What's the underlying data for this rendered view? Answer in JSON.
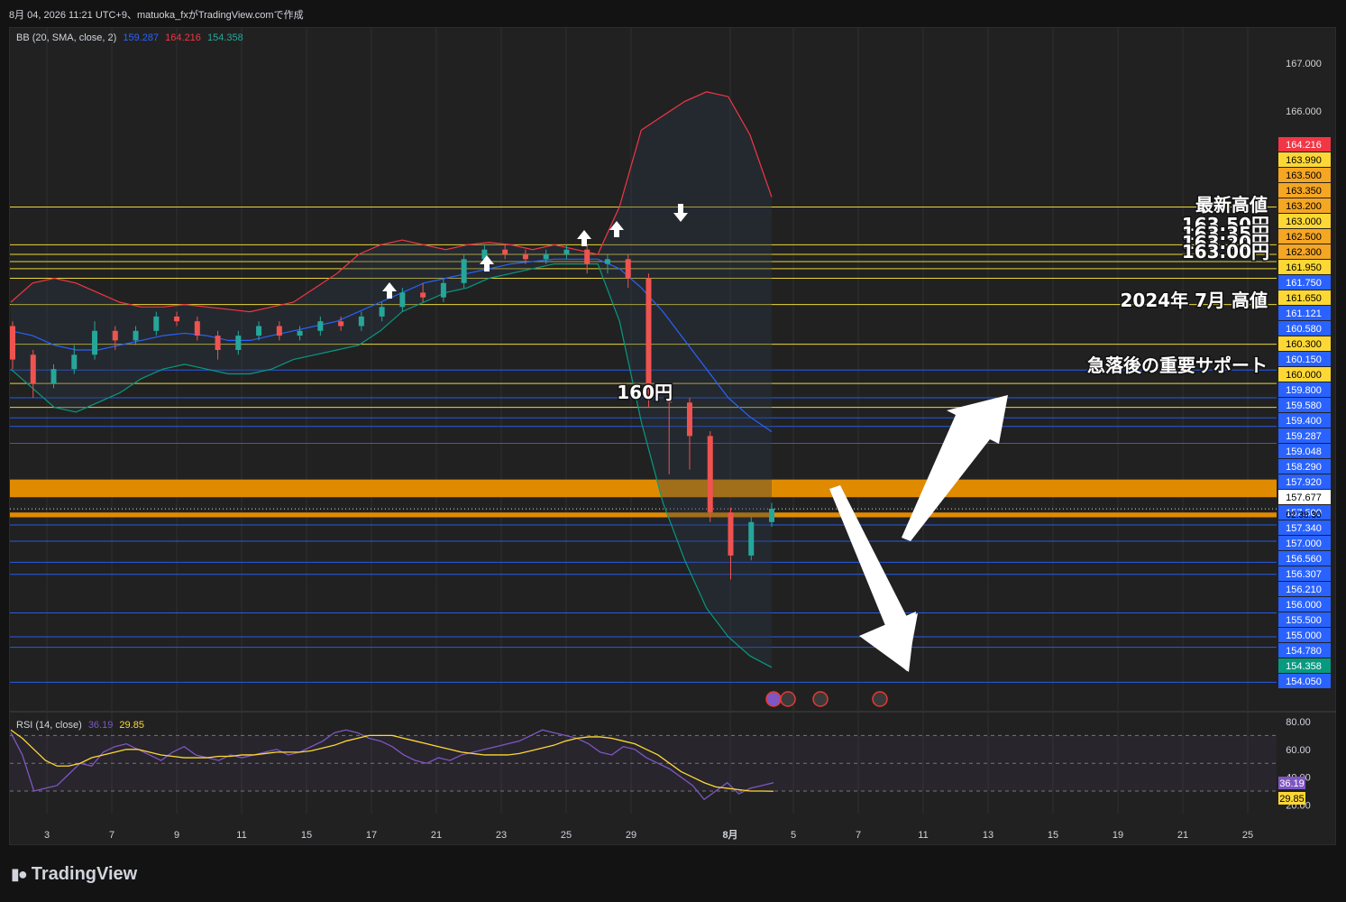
{
  "header": {
    "title": "8月 04, 2026 11:21 UTC+9、matuoka_fxがTradingView.comで作成"
  },
  "bb_legend": {
    "label": "BB (20, SMA, close, 2)",
    "basis": "159.287",
    "upper": "164.216",
    "lower": "154.358"
  },
  "rsi_legend": {
    "label": "RSI (14, close)",
    "rsi": "36.19",
    "ma": "29.85"
  },
  "logo": {
    "text": "TradingView"
  },
  "annotations": {
    "latest_high": "最新高値",
    "jul2024_high": "2024年 7月 高値",
    "support": "急落後の重要サポート",
    "yen160": "160円",
    "stack1": "163.50円",
    "stack2": "163.35円",
    "stack3": "163.20円",
    "stack4": "163.00円"
  },
  "colors": {
    "background": "#212121",
    "page": "#131313",
    "up": "#26a69a",
    "down": "#ef5350",
    "bb_upper": "#f23645",
    "bb_basis": "#2962ff",
    "bb_lower": "#089981",
    "yellow_line": "#ffeb3b",
    "blue_line": "#2962ff",
    "orange_zone": "#e08a00",
    "rsi": "#7e57c2",
    "rsi_ma": "#fdd835"
  },
  "chart_data": [
    {
      "type": "candlestick",
      "title": "",
      "x_tick_labels": [
        "3",
        "7",
        "9",
        "11",
        "15",
        "17",
        "21",
        "23",
        "25",
        "29",
        "8月",
        "5",
        "7",
        "11",
        "13",
        "15",
        "19",
        "21",
        "25"
      ],
      "y_ticks": [
        167.0,
        166.0
      ],
      "ylim": [
        153.7,
        167.5
      ],
      "price_axis_labels": [
        {
          "value": "164.216",
          "type": "bb_upper"
        },
        {
          "value": "163.990",
          "type": "yellow"
        },
        {
          "value": "163.500",
          "type": "orange"
        },
        {
          "value": "163.350",
          "type": "orange"
        },
        {
          "value": "163.200",
          "type": "orange"
        },
        {
          "value": "163.000",
          "type": "yellow"
        },
        {
          "value": "162.500",
          "type": "orange"
        },
        {
          "value": "162.300",
          "type": "orange"
        },
        {
          "value": "161.950",
          "type": "yellow"
        },
        {
          "value": "161.750",
          "type": "blue"
        },
        {
          "value": "161.650",
          "type": "yellow"
        },
        {
          "value": "161.121",
          "type": "blue"
        },
        {
          "value": "160.580",
          "type": "blue"
        },
        {
          "value": "160.300",
          "type": "yellow"
        },
        {
          "value": "160.150",
          "type": "blue"
        },
        {
          "value": "160.000",
          "type": "yellow"
        },
        {
          "value": "159.800",
          "type": "blue"
        },
        {
          "value": "159.580",
          "type": "blue"
        },
        {
          "value": "159.400",
          "type": "blue"
        },
        {
          "value": "159.287",
          "type": "blue"
        },
        {
          "value": "159.048",
          "type": "blue"
        },
        {
          "value": "158.290",
          "type": "blue"
        },
        {
          "value": "157.920",
          "type": "blue"
        },
        {
          "value": "157.677",
          "type": "current"
        },
        {
          "value": "157.500",
          "type": "blue"
        },
        {
          "value": "157.340",
          "type": "blue"
        },
        {
          "value": "157.000",
          "type": "blue"
        },
        {
          "value": "156.560",
          "type": "blue"
        },
        {
          "value": "156.307",
          "type": "blue"
        },
        {
          "value": "156.210",
          "type": "blue"
        },
        {
          "value": "156.000",
          "type": "blue"
        },
        {
          "value": "155.500",
          "type": "blue"
        },
        {
          "value": "155.000",
          "type": "blue"
        },
        {
          "value": "154.780",
          "type": "blue"
        },
        {
          "value": "154.358",
          "type": "bb_lower"
        },
        {
          "value": "154.050",
          "type": "blue"
        }
      ],
      "countdown": "02:38:30",
      "horizontal_levels": [
        {
          "price": 163.99,
          "color": "yellow"
        },
        {
          "price": 163.2,
          "color": "yellow"
        },
        {
          "price": 163.0,
          "color": "yellow"
        },
        {
          "price": 162.85,
          "color": "yellow"
        },
        {
          "price": 162.7,
          "color": "yellow"
        },
        {
          "price": 162.5,
          "color": "yellow"
        },
        {
          "price": 161.95,
          "color": "yellow"
        },
        {
          "price": 161.121,
          "color": "yellow"
        },
        {
          "price": 160.58,
          "color": "blue"
        },
        {
          "price": 160.3,
          "color": "yellow"
        },
        {
          "price": 160.0,
          "color": "blue"
        },
        {
          "price": 159.8,
          "color": "yellow"
        },
        {
          "price": 159.58,
          "color": "blue"
        },
        {
          "price": 159.4,
          "color": "blue"
        },
        {
          "price": 159.048,
          "color": "blue"
        },
        {
          "price": 157.34,
          "color": "blue"
        },
        {
          "price": 157.0,
          "color": "blue"
        },
        {
          "price": 156.56,
          "color": "blue"
        },
        {
          "price": 156.307,
          "color": "blue"
        },
        {
          "price": 155.5,
          "color": "blue"
        },
        {
          "price": 155.0,
          "color": "blue"
        },
        {
          "price": 154.78,
          "color": "blue"
        },
        {
          "price": 154.05,
          "color": "blue"
        }
      ],
      "zones": [
        {
          "from": 157.92,
          "to": 158.29,
          "color": "orange"
        },
        {
          "from": 157.5,
          "to": 157.6,
          "color": "orange"
        }
      ],
      "series": [
        {
          "kind": "candles",
          "points_open_close_high_low": [
            [
              161.5,
              160.8,
              161.6,
              160.6
            ],
            [
              160.9,
              160.3,
              161.0,
              160.0
            ],
            [
              160.3,
              160.6,
              160.7,
              160.2
            ],
            [
              160.6,
              160.9,
              161.1,
              160.5
            ],
            [
              160.9,
              161.4,
              161.6,
              160.8
            ],
            [
              161.4,
              161.2,
              161.5,
              161.0
            ],
            [
              161.2,
              161.4,
              161.5,
              161.1
            ],
            [
              161.4,
              161.7,
              161.8,
              161.3
            ],
            [
              161.7,
              161.6,
              161.8,
              161.5
            ],
            [
              161.6,
              161.3,
              161.7,
              161.2
            ],
            [
              161.3,
              161.0,
              161.4,
              160.8
            ],
            [
              161.0,
              161.3,
              161.4,
              160.9
            ],
            [
              161.3,
              161.5,
              161.6,
              161.2
            ],
            [
              161.5,
              161.3,
              161.6,
              161.2
            ],
            [
              161.3,
              161.4,
              161.5,
              161.2
            ],
            [
              161.4,
              161.6,
              161.7,
              161.3
            ],
            [
              161.6,
              161.5,
              161.7,
              161.4
            ],
            [
              161.5,
              161.7,
              161.8,
              161.4
            ],
            [
              161.7,
              161.9,
              162.0,
              161.6
            ],
            [
              161.9,
              162.2,
              162.3,
              161.8
            ],
            [
              162.2,
              162.1,
              162.4,
              162.0
            ],
            [
              162.1,
              162.4,
              162.5,
              162.0
            ],
            [
              162.4,
              162.9,
              163.0,
              162.3
            ],
            [
              162.9,
              163.1,
              163.2,
              162.8
            ],
            [
              163.1,
              163.0,
              163.2,
              162.9
            ],
            [
              163.0,
              162.9,
              163.1,
              162.8
            ],
            [
              162.9,
              163.0,
              163.1,
              162.8
            ],
            [
              163.0,
              163.1,
              163.2,
              162.9
            ],
            [
              163.1,
              162.8,
              163.2,
              162.6
            ],
            [
              162.8,
              162.9,
              163.0,
              162.6
            ],
            [
              162.9,
              162.5,
              163.0,
              162.3
            ],
            [
              162.5,
              160.0,
              162.6,
              159.8
            ],
            [
              160.0,
              159.9,
              160.1,
              158.4
            ],
            [
              159.9,
              159.2,
              160.0,
              158.5
            ],
            [
              159.2,
              157.6,
              159.3,
              157.4
            ],
            [
              157.6,
              156.7,
              157.7,
              156.2
            ],
            [
              156.7,
              157.4,
              157.5,
              156.6
            ],
            [
              157.4,
              157.68,
              157.8,
              157.3
            ]
          ]
        },
        {
          "name": "",
          "kind": "bb_upper",
          "values": [
            162.0,
            162.4,
            162.5,
            162.4,
            162.2,
            162.0,
            161.9,
            161.9,
            161.95,
            161.9,
            161.85,
            161.8,
            161.9,
            162.0,
            162.3,
            162.6,
            163.0,
            163.2,
            163.3,
            163.2,
            163.1,
            163.2,
            163.25,
            163.2,
            163.1,
            163.2,
            163.1,
            163.0,
            164.0,
            165.6,
            165.9,
            166.2,
            166.4,
            166.3,
            165.5,
            164.2
          ]
        },
        {
          "name": "",
          "kind": "bb_basis",
          "values": [
            161.4,
            161.3,
            161.1,
            161.0,
            161.0,
            161.1,
            161.2,
            161.3,
            161.35,
            161.3,
            161.2,
            161.2,
            161.3,
            161.4,
            161.5,
            161.6,
            161.8,
            162.0,
            162.2,
            162.4,
            162.5,
            162.6,
            162.7,
            162.8,
            162.85,
            162.9,
            162.9,
            162.9,
            162.7,
            162.3,
            161.8,
            161.2,
            160.6,
            160.0,
            159.6,
            159.29
          ]
        },
        {
          "name": "",
          "kind": "bb_lower",
          "values": [
            160.6,
            160.2,
            159.8,
            159.7,
            159.9,
            160.1,
            160.4,
            160.6,
            160.7,
            160.6,
            160.5,
            160.5,
            160.6,
            160.8,
            160.9,
            161.0,
            161.1,
            161.4,
            161.8,
            162.0,
            162.2,
            162.3,
            162.5,
            162.6,
            162.7,
            162.8,
            162.8,
            162.8,
            161.6,
            159.5,
            157.8,
            156.6,
            155.6,
            155.0,
            154.6,
            154.36
          ]
        }
      ]
    },
    {
      "type": "line",
      "title": "",
      "y_ticks": [
        80.0,
        60.0,
        40.0,
        20.0
      ],
      "ylim": [
        17,
        83
      ],
      "bands": [
        70,
        50,
        30
      ],
      "series": [
        {
          "name": "",
          "kind": "rsi",
          "values": [
            72,
            56,
            30,
            32,
            34,
            42,
            50,
            48,
            58,
            62,
            64,
            60,
            56,
            52,
            58,
            62,
            56,
            54,
            52,
            56,
            54,
            56,
            58,
            60,
            56,
            58,
            62,
            66,
            72,
            74,
            72,
            68,
            66,
            62,
            56,
            52,
            50,
            54,
            52,
            56,
            58,
            60,
            62,
            64,
            66,
            70,
            74,
            72,
            70,
            68,
            64,
            58,
            56,
            62,
            60,
            54,
            50,
            46,
            40,
            34,
            24,
            30,
            36,
            28,
            32,
            34,
            36
          ]
        },
        {
          "name": "",
          "kind": "rsi_ma",
          "values": [
            74,
            68,
            60,
            52,
            48,
            48,
            50,
            54,
            56,
            58,
            60,
            60,
            58,
            56,
            55,
            54,
            54,
            54,
            55,
            55,
            56,
            56,
            57,
            58,
            58,
            58,
            59,
            61,
            63,
            66,
            68,
            70,
            70,
            70,
            68,
            66,
            64,
            62,
            60,
            58,
            57,
            56,
            56,
            56,
            57,
            59,
            61,
            63,
            66,
            68,
            69,
            69,
            68,
            66,
            64,
            60,
            56,
            50,
            44,
            40,
            36,
            33,
            32,
            31,
            30,
            30,
            29.85
          ]
        }
      ]
    }
  ]
}
